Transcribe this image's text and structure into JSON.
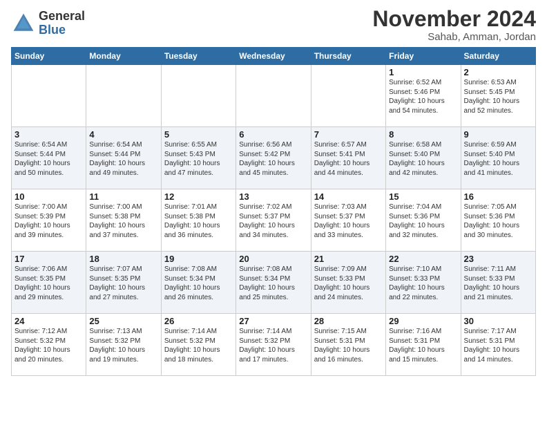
{
  "header": {
    "logo_general": "General",
    "logo_blue": "Blue",
    "month_title": "November 2024",
    "location": "Sahab, Amman, Jordan"
  },
  "days_of_week": [
    "Sunday",
    "Monday",
    "Tuesday",
    "Wednesday",
    "Thursday",
    "Friday",
    "Saturday"
  ],
  "weeks": [
    [
      {
        "day": "",
        "info": ""
      },
      {
        "day": "",
        "info": ""
      },
      {
        "day": "",
        "info": ""
      },
      {
        "day": "",
        "info": ""
      },
      {
        "day": "",
        "info": ""
      },
      {
        "day": "1",
        "info": "Sunrise: 6:52 AM\nSunset: 5:46 PM\nDaylight: 10 hours and 54 minutes."
      },
      {
        "day": "2",
        "info": "Sunrise: 6:53 AM\nSunset: 5:45 PM\nDaylight: 10 hours and 52 minutes."
      }
    ],
    [
      {
        "day": "3",
        "info": "Sunrise: 6:54 AM\nSunset: 5:44 PM\nDaylight: 10 hours and 50 minutes."
      },
      {
        "day": "4",
        "info": "Sunrise: 6:54 AM\nSunset: 5:44 PM\nDaylight: 10 hours and 49 minutes."
      },
      {
        "day": "5",
        "info": "Sunrise: 6:55 AM\nSunset: 5:43 PM\nDaylight: 10 hours and 47 minutes."
      },
      {
        "day": "6",
        "info": "Sunrise: 6:56 AM\nSunset: 5:42 PM\nDaylight: 10 hours and 45 minutes."
      },
      {
        "day": "7",
        "info": "Sunrise: 6:57 AM\nSunset: 5:41 PM\nDaylight: 10 hours and 44 minutes."
      },
      {
        "day": "8",
        "info": "Sunrise: 6:58 AM\nSunset: 5:40 PM\nDaylight: 10 hours and 42 minutes."
      },
      {
        "day": "9",
        "info": "Sunrise: 6:59 AM\nSunset: 5:40 PM\nDaylight: 10 hours and 41 minutes."
      }
    ],
    [
      {
        "day": "10",
        "info": "Sunrise: 7:00 AM\nSunset: 5:39 PM\nDaylight: 10 hours and 39 minutes."
      },
      {
        "day": "11",
        "info": "Sunrise: 7:00 AM\nSunset: 5:38 PM\nDaylight: 10 hours and 37 minutes."
      },
      {
        "day": "12",
        "info": "Sunrise: 7:01 AM\nSunset: 5:38 PM\nDaylight: 10 hours and 36 minutes."
      },
      {
        "day": "13",
        "info": "Sunrise: 7:02 AM\nSunset: 5:37 PM\nDaylight: 10 hours and 34 minutes."
      },
      {
        "day": "14",
        "info": "Sunrise: 7:03 AM\nSunset: 5:37 PM\nDaylight: 10 hours and 33 minutes."
      },
      {
        "day": "15",
        "info": "Sunrise: 7:04 AM\nSunset: 5:36 PM\nDaylight: 10 hours and 32 minutes."
      },
      {
        "day": "16",
        "info": "Sunrise: 7:05 AM\nSunset: 5:36 PM\nDaylight: 10 hours and 30 minutes."
      }
    ],
    [
      {
        "day": "17",
        "info": "Sunrise: 7:06 AM\nSunset: 5:35 PM\nDaylight: 10 hours and 29 minutes."
      },
      {
        "day": "18",
        "info": "Sunrise: 7:07 AM\nSunset: 5:35 PM\nDaylight: 10 hours and 27 minutes."
      },
      {
        "day": "19",
        "info": "Sunrise: 7:08 AM\nSunset: 5:34 PM\nDaylight: 10 hours and 26 minutes."
      },
      {
        "day": "20",
        "info": "Sunrise: 7:08 AM\nSunset: 5:34 PM\nDaylight: 10 hours and 25 minutes."
      },
      {
        "day": "21",
        "info": "Sunrise: 7:09 AM\nSunset: 5:33 PM\nDaylight: 10 hours and 24 minutes."
      },
      {
        "day": "22",
        "info": "Sunrise: 7:10 AM\nSunset: 5:33 PM\nDaylight: 10 hours and 22 minutes."
      },
      {
        "day": "23",
        "info": "Sunrise: 7:11 AM\nSunset: 5:33 PM\nDaylight: 10 hours and 21 minutes."
      }
    ],
    [
      {
        "day": "24",
        "info": "Sunrise: 7:12 AM\nSunset: 5:32 PM\nDaylight: 10 hours and 20 minutes."
      },
      {
        "day": "25",
        "info": "Sunrise: 7:13 AM\nSunset: 5:32 PM\nDaylight: 10 hours and 19 minutes."
      },
      {
        "day": "26",
        "info": "Sunrise: 7:14 AM\nSunset: 5:32 PM\nDaylight: 10 hours and 18 minutes."
      },
      {
        "day": "27",
        "info": "Sunrise: 7:14 AM\nSunset: 5:32 PM\nDaylight: 10 hours and 17 minutes."
      },
      {
        "day": "28",
        "info": "Sunrise: 7:15 AM\nSunset: 5:31 PM\nDaylight: 10 hours and 16 minutes."
      },
      {
        "day": "29",
        "info": "Sunrise: 7:16 AM\nSunset: 5:31 PM\nDaylight: 10 hours and 15 minutes."
      },
      {
        "day": "30",
        "info": "Sunrise: 7:17 AM\nSunset: 5:31 PM\nDaylight: 10 hours and 14 minutes."
      }
    ]
  ]
}
